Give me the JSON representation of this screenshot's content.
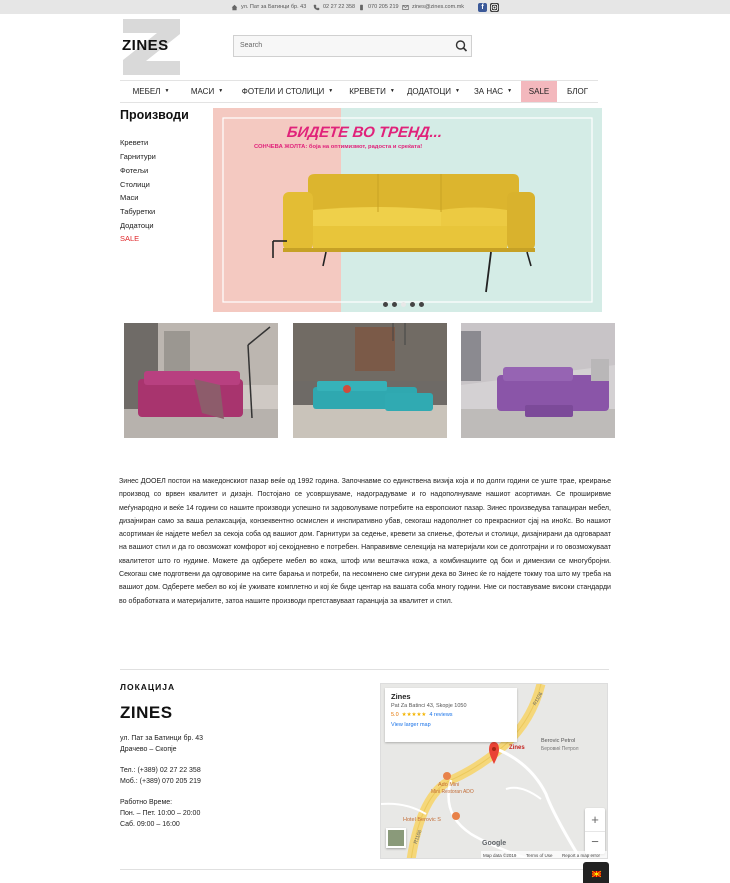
{
  "topbar": {
    "address": "ул. Пат за Батинци бр. 43",
    "phone1": "02 27 22 358",
    "phone2": "070 205 219",
    "email": "zines@zines.com.mk",
    "colors": {
      "facebook": "#3b5998",
      "instagram": "#333333"
    }
  },
  "header": {
    "logo_text": "ZINES",
    "search_placeholder": "Search"
  },
  "nav": {
    "items": [
      {
        "label": "МЕБЕЛ",
        "has_dropdown": true
      },
      {
        "label": "МАСИ",
        "has_dropdown": true
      },
      {
        "label": "ФОТЕЛИ И СТОЛИЦИ",
        "has_dropdown": true
      },
      {
        "label": "КРЕВЕТИ",
        "has_dropdown": true
      },
      {
        "label": "ДОДАТОЦИ",
        "has_dropdown": true
      },
      {
        "label": "ЗА НАС",
        "has_dropdown": true
      },
      {
        "label": "SALE",
        "has_dropdown": false
      },
      {
        "label": "БЛОГ",
        "has_dropdown": false
      }
    ],
    "sale_bg": "#f3b8bd"
  },
  "sidebar": {
    "title": "Производи",
    "links": [
      "Кревети",
      "Гарнитури",
      "Фотељи",
      "Столици",
      "Маси",
      "Табуретки",
      "Додатоци",
      "SALE"
    ],
    "sale_color": "#e0262a"
  },
  "banner": {
    "headline": "БИДЕТЕ ВО ТРЕНД...",
    "subline": "СОНЧЕВА ЖОЛТА: боја на оптимизмот, радоста и среќата!",
    "colors": {
      "left": "#f4c9c1",
      "right": "#d4ece6",
      "sofa": "#e8c53a",
      "accent": "#e0227a"
    },
    "slide_count": 5,
    "active_slide": 3
  },
  "about": {
    "text": "Зинес ДООЕЛ постои на македонскиот пазар веќе од 1992 година. Започнавме со единствена визија која и по долги години се уште трае, креирање производ со врвен квалитет и дизајн. Постојано се усовршуваме, надоградуваме и го надополнуваме нашиот асортиман. Се проширивме меѓународно и веќе 14 години со нашите производи успешно ги задоволуваме потребите на европскиот пазар. Зинес произведува тапациран мебел, дизајниран само за ваша релаксација, конзеквентно осмислен и инспиративно убав, секогаш надополнет со прекрасниот сјај на иноКс. Во нашиот асортиман ќе најдете мебел за секоја соба од вашиот дом. Гарнитури за седење, кревети за спиење, фотељи и столици, дизајнирани да одговараат на вашиот стил и да го овозможат комфорот кој секојдневно е потребен. Направивме селекција на материјали кои се долготрајни и го овозможуваат квалитетот што го нудиме. Можете да одберете мебел во кожа, штоф или вештачка кожа, а комбинациите од бои и димензии се многубројни. Секогаш сме подготвени да одговориме на сите барања и потреби, па несомнено сме сигурни дека во Зинес ќе го најдете токму тоа што му треба на вашиот дом. Одберете мебел во кој ќе уживате комплетно и кој ќе биде центар на вашата соба многу години. Ние си поставуваме високи стандарди во обработката и материјалите, затоа нашите производи претставуваат гаранција за квалитет и стил."
  },
  "footer": {
    "location_title": "ЛОКАЦИЈА",
    "logo_text": "ZINES",
    "address_line1": "ул. Пат за Батинци бр. 43",
    "address_line2": "Драчево – Скопје",
    "tel": "Тел.: (+389) 02 27 22 358",
    "mob": "Моб.: (+389) 070 205 219",
    "hours_title": "Работно Време:",
    "hours_weekdays": "Пон. – Пет. 10:00 – 20:00",
    "hours_saturday": "Саб. 09:00 – 16:00"
  },
  "map": {
    "place_name": "Zines",
    "place_address": "Pat Za Batinci 43, Skopje 1050",
    "rating": "5.0",
    "stars": "★★★★★",
    "reviews": "4 reviews",
    "larger_map": "View larger map",
    "pin_label": "Zines",
    "poi1_label": "Berovic Petrol",
    "poi1_sub": "Беровиќ Петрол",
    "poi2_label": "Ado Mini",
    "poi2_sub": "Mini Restoran ADO",
    "poi3_label": "Hotel Berovic S",
    "road1": "R1106",
    "road2": "R1106",
    "google": "Google",
    "map_data": "Map data ©2019",
    "terms": "Terms of Use",
    "report": "Report a map error",
    "zoom_in": "+",
    "zoom_out": "−",
    "colors": {
      "road": "#f5d77a",
      "pin": "#ea4335",
      "poi": "#e8824a",
      "link": "#1a73e8",
      "star": "#f4b400"
    }
  }
}
